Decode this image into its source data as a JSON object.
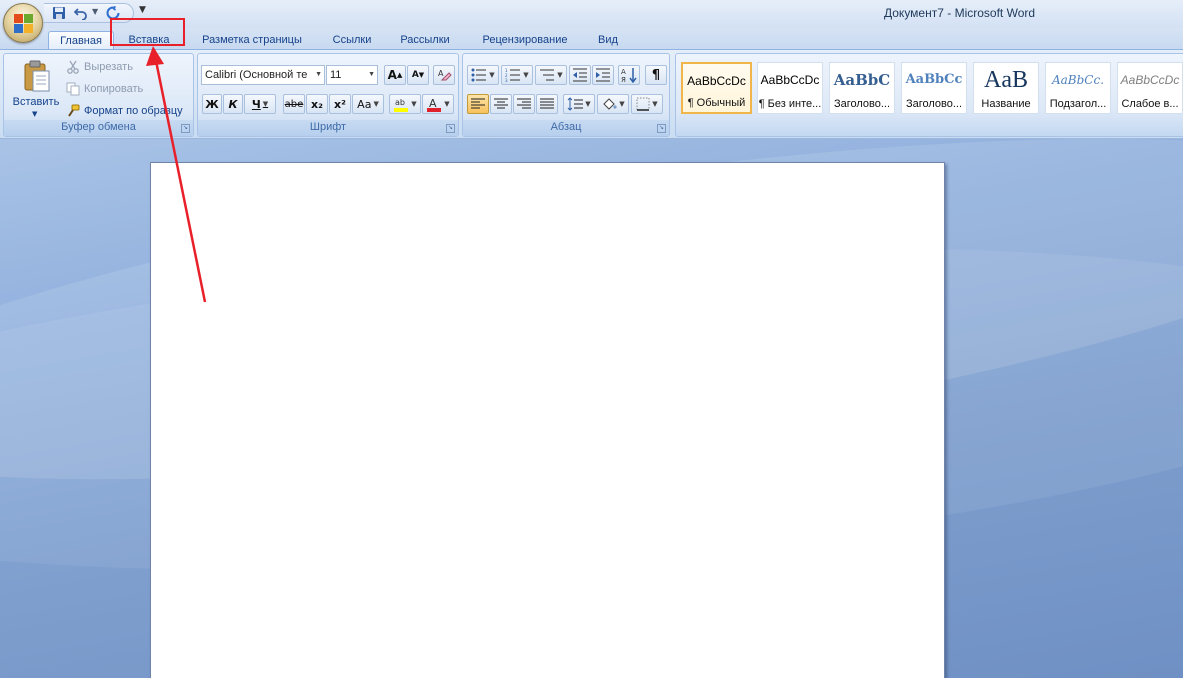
{
  "window": {
    "title": "Документ7 - Microsoft Word"
  },
  "quick_access": {
    "items": [
      {
        "name": "save",
        "icon": "save-icon"
      },
      {
        "name": "undo",
        "icon": "undo-icon"
      },
      {
        "name": "redo",
        "icon": "redo-icon"
      }
    ],
    "customize_glyph": "▼"
  },
  "tabs": [
    {
      "label": "Главная",
      "active": true
    },
    {
      "label": "Вставка",
      "active": false
    },
    {
      "label": "Разметка страницы",
      "active": false
    },
    {
      "label": "Ссылки",
      "active": false
    },
    {
      "label": "Рассылки",
      "active": false
    },
    {
      "label": "Рецензирование",
      "active": false
    },
    {
      "label": "Вид",
      "active": false
    }
  ],
  "ribbon": {
    "clipboard": {
      "label": "Буфер обмена",
      "paste": "Вставить",
      "cut": "Вырезать",
      "copy": "Копировать",
      "format_painter": "Формат по образцу"
    },
    "font": {
      "label": "Шрифт",
      "font_name": "Calibri (Основной те",
      "font_size": "11",
      "bold": "Ж",
      "italic": "К",
      "underline": "Ч",
      "strike": "abe",
      "subscript": "x₂",
      "superscript": "x²",
      "change_case": "Aa",
      "grow": "A",
      "shrink": "A",
      "highlight_color": "#ffff00",
      "font_color": "#e0202a"
    },
    "paragraph": {
      "label": "Абзац",
      "pilcrow": "¶"
    },
    "styles": {
      "items": [
        {
          "sample": "AaBbCcDc",
          "name": "¶ Обычный",
          "selected": true
        },
        {
          "sample": "AaBbCcDc",
          "name": "¶ Без инте...",
          "selected": false
        },
        {
          "sample": "AaBbC",
          "name": "Заголово...",
          "selected": false
        },
        {
          "sample": "AaBbCc",
          "name": "Заголово...",
          "selected": false
        },
        {
          "sample": "AaB",
          "name": "Название",
          "selected": false
        },
        {
          "sample": "AaBbCc.",
          "name": "Подзагол...",
          "selected": false
        },
        {
          "sample": "AaBbCcDc",
          "name": "Слабое в...",
          "selected": false
        }
      ]
    }
  },
  "annotation": {
    "color": "#e8202a"
  }
}
